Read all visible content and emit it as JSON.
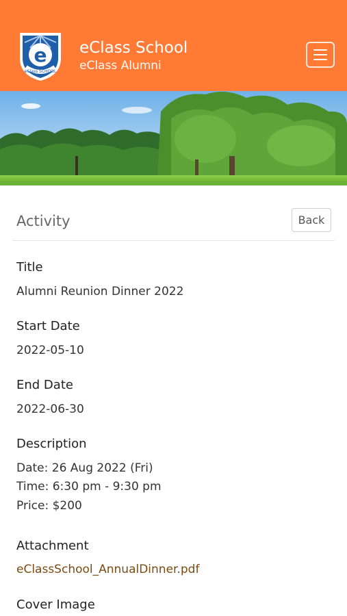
{
  "header": {
    "title": "eClass School",
    "subtitle": "eClass Alumni",
    "logo_letter": "e",
    "logo_text": "eClass SCHOOL",
    "background_color": "#ff7a35"
  },
  "section": {
    "title": "Activity",
    "back_label": "Back"
  },
  "fields": {
    "title_label": "Title",
    "title_value": "Alumni Reunion Dinner 2022",
    "start_label": "Start Date",
    "start_value": "2022-05-10",
    "end_label": "End Date",
    "end_value": "2022-06-30",
    "description_label": "Description",
    "description_lines": [
      "Date: 26 Aug 2022 (Fri)",
      "Time: 6:30 pm - 9:30 pm",
      "Price: $200"
    ],
    "attachment_label": "Attachment",
    "attachment_name": "eClassSchool_AnnualDinner.pdf",
    "cover_label": "Cover Image"
  },
  "icons": {
    "menu": "hamburger-menu-icon",
    "logo": "school-shield-logo"
  },
  "colors": {
    "accent": "#ff7a35",
    "link": "#7a4b12"
  }
}
